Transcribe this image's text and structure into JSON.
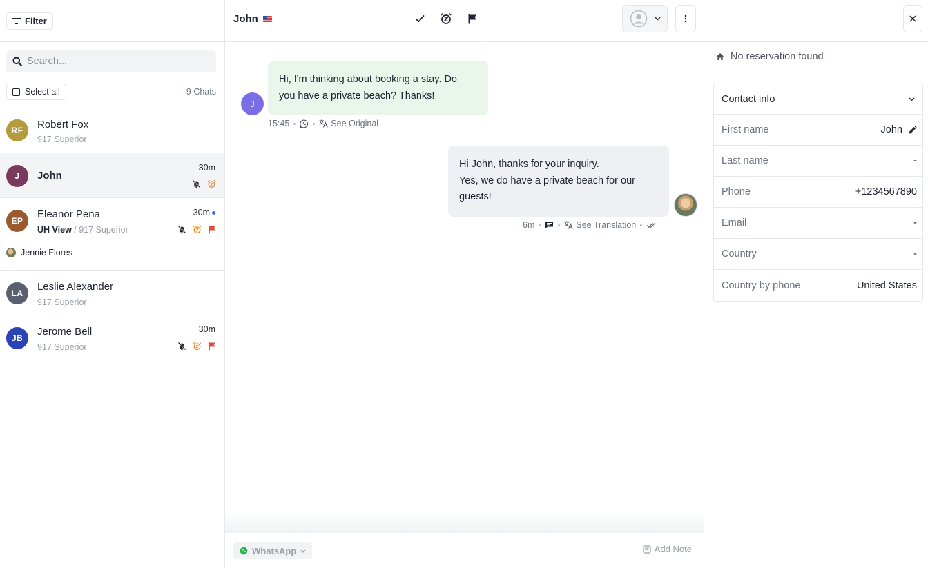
{
  "colors": {
    "accent_blue": "#3b6fe0",
    "alarm_orange": "#f0902e",
    "flag_red": "#e34b3b",
    "whatsapp_green": "#25b54a",
    "incoming_bubble": "#eaf6ec",
    "outgoing_bubble": "#eef0f4"
  },
  "sidebar": {
    "filter_label": "Filter",
    "search_placeholder": "Search...",
    "select_all_label": "Select all",
    "chat_count": "9 Chats",
    "chats": [
      {
        "initials": "RF",
        "name": "Robert Fox",
        "subtitle": "917 Superior",
        "avatar_color": "#b59a3e"
      },
      {
        "initials": "J",
        "name": "John",
        "time": "30m",
        "avatar_color": "#7a3a5c",
        "icons": [
          "muted-bell-icon",
          "alarm-icon"
        ]
      },
      {
        "initials": "EP",
        "name": "Eleanor Pena",
        "property": "UH View",
        "subtitle": "917 Superior",
        "time": "30m",
        "unread": true,
        "avatar_color": "#9a5a2e",
        "assignee": "Jennie Flores",
        "icons": [
          "muted-bell-icon",
          "alarm-icon",
          "flag-icon"
        ]
      },
      {
        "initials": "LA",
        "name": "Leslie Alexander",
        "subtitle": "917 Superior",
        "avatar_color": "#5a6070"
      },
      {
        "initials": "JB",
        "name": "Jerome Bell",
        "subtitle": "917 Superior",
        "time": "30m",
        "avatar_color": "#2a44b8",
        "icons": [
          "muted-bell-icon",
          "alarm-icon",
          "flag-icon"
        ]
      }
    ]
  },
  "conversation": {
    "contact_name": "John",
    "contact_flag": "us-flag-icon",
    "toolbar_icons": [
      "check-icon",
      "snooze-alarm-icon",
      "flag-icon"
    ],
    "messages": [
      {
        "direction": "in",
        "avatar_initial": "J",
        "lines": [
          "Hi, I'm thinking about booking a stay. Do",
          "you have a private beach? Thanks!"
        ],
        "time": "15:45",
        "channel_icon": "whatsapp-icon",
        "translate_label": "See Original"
      },
      {
        "direction": "out",
        "lines": [
          "Hi John, thanks for your inquiry.",
          "Yes, we do have a private beach for our",
          "guests!"
        ],
        "time": "6m",
        "channel_icon": "chat-icon",
        "translate_label": "See Translation",
        "status_icon": "double-check-icon"
      }
    ],
    "composer": {
      "channel_label": "WhatsApp",
      "add_note_label": "Add Note"
    }
  },
  "details": {
    "no_reservation": "No reservation found",
    "contact_info_title": "Contact info",
    "fields": [
      {
        "label": "First name",
        "value": "John",
        "editable": true
      },
      {
        "label": "Last name",
        "value": "-"
      },
      {
        "label": "Phone",
        "value": "+1234567890"
      },
      {
        "label": "Email",
        "value": "-"
      },
      {
        "label": "Country",
        "value": "-"
      },
      {
        "label": "Country by phone",
        "value": "United States"
      }
    ]
  }
}
